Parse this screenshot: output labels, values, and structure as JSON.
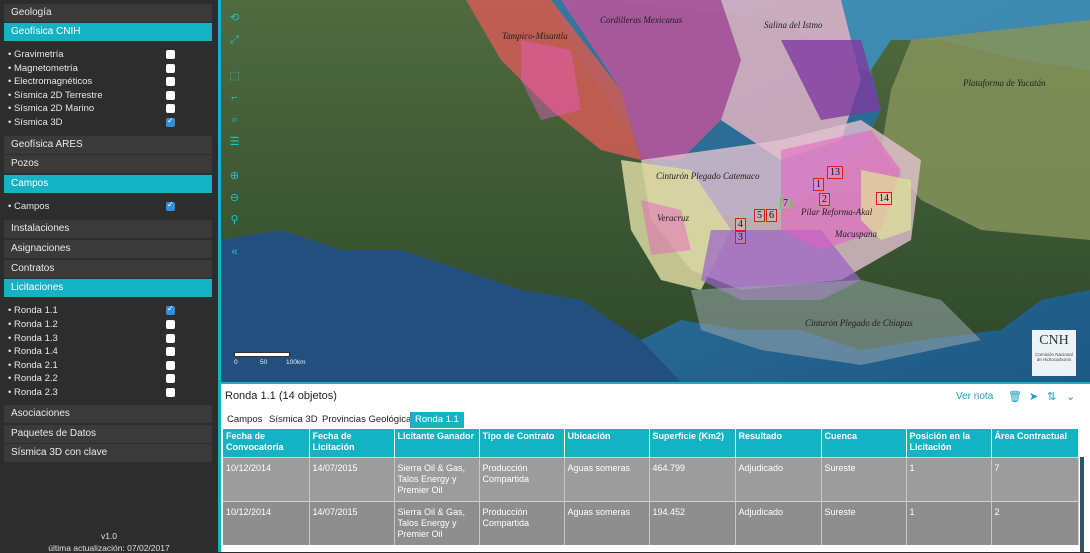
{
  "sidebar": {
    "geologia": "Geología",
    "geofisica_cnih": "Geofísica CNIH",
    "geo_items": [
      {
        "label": "• Gravimetría",
        "checked": false
      },
      {
        "label": "• Magnetometría",
        "checked": false
      },
      {
        "label": "• Electromagnéticos",
        "checked": false
      },
      {
        "label": "• Sísmica 2D Terrestre",
        "checked": false
      },
      {
        "label": "• Sísmica 2D Marino",
        "checked": false
      },
      {
        "label": "• Sísmica 3D",
        "checked": true
      }
    ],
    "geofisica_ares": "Geofísica ARES",
    "pozos": "Pozos",
    "campos": "Campos",
    "campos_items": [
      {
        "label": "• Campos",
        "checked": true
      }
    ],
    "instalaciones": "Instalaciones",
    "asignaciones": "Asignaciones",
    "contratos": "Contratos",
    "licitaciones": "Licitaciones",
    "licit_items": [
      {
        "label": "• Ronda 1.1",
        "checked": true
      },
      {
        "label": "• Ronda 1.2",
        "checked": false
      },
      {
        "label": "• Ronda 1.3",
        "checked": false
      },
      {
        "label": "• Ronda 1.4",
        "checked": false
      },
      {
        "label": "• Ronda 2.1",
        "checked": false
      },
      {
        "label": "• Ronda 2.2",
        "checked": false
      },
      {
        "label": "• Ronda 2.3",
        "checked": false
      }
    ],
    "asociaciones": "Asociaciones",
    "paquetes": "Paquetes de Datos",
    "sismica_clave": "Sísmica 3D con clave",
    "version": "v1.0",
    "updated": "última actualización: 07/02/2017"
  },
  "map": {
    "labels": {
      "cordilleras": "Cordilleras Mexicanas",
      "salina": "Salina del Istmo",
      "tampico": "Tampico-Misantla",
      "yucatan": "Plataforma de Yucatán",
      "catemaco": "Cinturón Plegado Catemaco",
      "veracruz": "Veracruz",
      "pilar": "Pilar Reforma-Akal",
      "macuspana": "Macuspana",
      "chiapas": "Cinturón Plegado de Chiapas"
    },
    "blocks": [
      "13",
      "1",
      "2",
      "7",
      "5",
      "6",
      "4",
      "3",
      "14"
    ],
    "scale_labels": [
      "0",
      "50",
      "100km"
    ],
    "logo_text": "CNH",
    "logo_sub": "Comisión Nacional de Hidrocarburos",
    "colors": {
      "accent": "#14b3c4",
      "block_border": "#e01b1b",
      "block_green": "#52d34a"
    }
  },
  "panel": {
    "title": "Ronda 1.1 (14 objetos)",
    "ver_nota": "Ver nota",
    "tabs": [
      "Campos",
      "Sísmica 3D",
      "Provincias Geológicas",
      "Ronda 1.1"
    ],
    "headers": [
      "Fecha de Convocatoria",
      "Fecha de Licitación",
      "Licitante Ganador",
      "Tipo de Contrato",
      "Ubicación",
      "Superficie (Km2)",
      "Resultado",
      "Cuenca",
      "Posición en la Licitación",
      "Área Contractual"
    ],
    "rows": [
      [
        "10/12/2014",
        "14/07/2015",
        "Sierra Oil & Gas, Talos Energy y Premier Oil",
        "Producción Compartida",
        "Aguas someras",
        "464.799",
        "Adjudicado",
        "Sureste",
        "1",
        "7"
      ],
      [
        "10/12/2014",
        "14/07/2015",
        "Sierra Oil & Gas, Talos Energy y Premier Oil",
        "Producción Compartida",
        "Aguas someras",
        "194.452",
        "Adjudicado",
        "Sureste",
        "1",
        "2"
      ]
    ]
  }
}
